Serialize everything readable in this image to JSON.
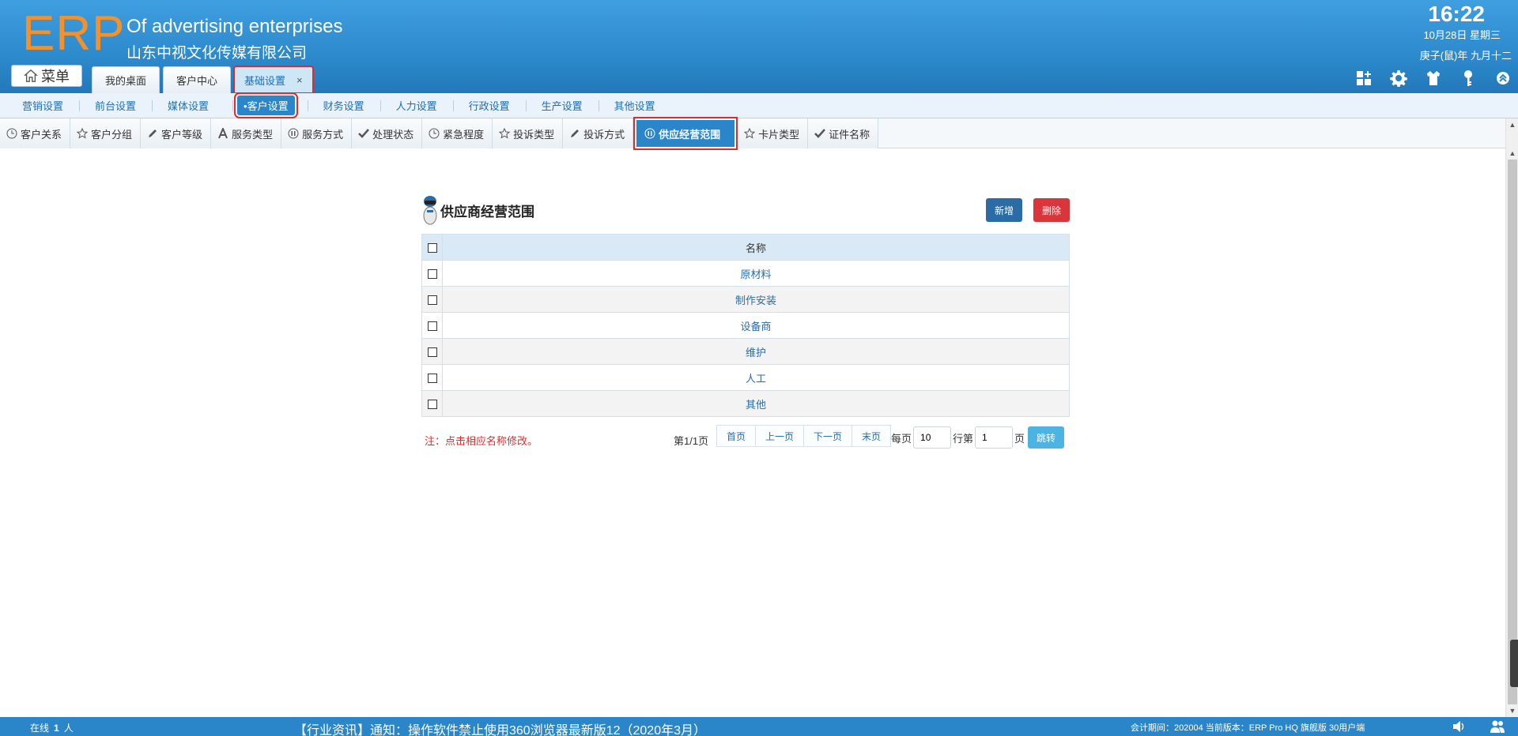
{
  "header": {
    "logo": "ERP",
    "company_en": "Of advertising enterprises",
    "company_cn": "山东中视文化传媒有限公司",
    "menu_label": "菜单",
    "time": "16:22",
    "date_line1": "10月28日 星期三",
    "date_line2": "庚子(鼠)年 九月十二",
    "tabs": [
      {
        "label": "我的桌面"
      },
      {
        "label": "客户中心"
      },
      {
        "label": "基础设置",
        "close": "×"
      }
    ]
  },
  "nav2": [
    {
      "label": "营销设置"
    },
    {
      "label": "前台设置"
    },
    {
      "label": "媒体设置"
    },
    {
      "label": "•客户设置"
    },
    {
      "label": "财务设置"
    },
    {
      "label": "人力设置"
    },
    {
      "label": "行政设置"
    },
    {
      "label": "生产设置"
    },
    {
      "label": "其他设置"
    }
  ],
  "nav3": [
    {
      "label": "客户关系",
      "icon": "clock-icon"
    },
    {
      "label": "客户分组",
      "icon": "star-icon"
    },
    {
      "label": "客户等级",
      "icon": "pencil-icon"
    },
    {
      "label": "服务类型",
      "icon": "letter-a-icon"
    },
    {
      "label": "服务方式",
      "icon": "pause-icon"
    },
    {
      "label": "处理状态",
      "icon": "check-icon"
    },
    {
      "label": "紧急程度",
      "icon": "clock-icon"
    },
    {
      "label": "投诉类型",
      "icon": "star-icon"
    },
    {
      "label": "投诉方式",
      "icon": "pencil-icon"
    },
    {
      "label": "供应经营范围",
      "icon": "pause-icon"
    },
    {
      "label": "卡片类型",
      "icon": "star-icon"
    },
    {
      "label": "证件名称",
      "icon": "check-icon"
    }
  ],
  "panel": {
    "title": "供应商经营范围",
    "add_label": "新增",
    "delete_label": "删除",
    "column_name": "名称",
    "rows": [
      "原材料",
      "制作安装",
      "设备商",
      "维护",
      "人工",
      "其他"
    ],
    "note": "注：点击相应名称修改。",
    "page_info": "第1/1页",
    "pager": [
      "首页",
      "上一页",
      "下一页",
      "末页"
    ],
    "per_page_label": "每页",
    "per_page_value": "10",
    "row_label": "行第",
    "page_value": "1",
    "page_label": "页",
    "jump_label": "跳转"
  },
  "status": {
    "online_label": "在线",
    "online_count": "1",
    "online_unit": "人",
    "news": "【行业资讯】通知：操作软件禁止使用360浏览器最新版12（2020年3月）",
    "account_info": "会计期间：202004 当前版本：ERP Pro HQ 旗舰版 30用户端"
  },
  "colors": {
    "header_blue": "#2a86c8",
    "logo_orange": "#f5912b",
    "highlight_red": "#e12a2a",
    "link_blue": "#2a6ea8"
  }
}
